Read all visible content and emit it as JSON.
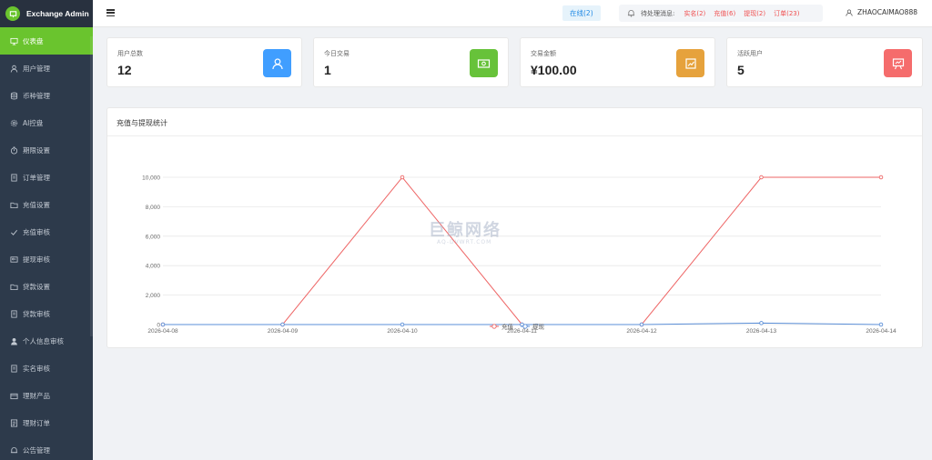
{
  "brand": {
    "title": "Exchange Admin"
  },
  "sidebar": {
    "items": [
      {
        "label": "仪表盘",
        "icon": "dashboard-icon",
        "active": true
      },
      {
        "label": "用户管理",
        "icon": "user-icon"
      },
      {
        "label": "币种管理",
        "icon": "database-icon"
      },
      {
        "label": "AI控盘",
        "icon": "gear-icon"
      },
      {
        "label": "期限设置",
        "icon": "timer-icon"
      },
      {
        "label": "订单管理",
        "icon": "document-icon"
      },
      {
        "label": "充值设置",
        "icon": "folder-icon"
      },
      {
        "label": "充值审核",
        "icon": "check-icon"
      },
      {
        "label": "提现审核",
        "icon": "card-icon"
      },
      {
        "label": "贷款设置",
        "icon": "folder-icon"
      },
      {
        "label": "贷款审核",
        "icon": "document-icon"
      },
      {
        "label": "个人信息审核",
        "icon": "person-filled-icon"
      },
      {
        "label": "实名审核",
        "icon": "document-icon"
      },
      {
        "label": "理财产品",
        "icon": "wallet-icon"
      },
      {
        "label": "理财订单",
        "icon": "list-icon"
      },
      {
        "label": "公告管理",
        "icon": "bell-icon"
      }
    ]
  },
  "header": {
    "online": "在线(2)",
    "pending_label": "待处理消息:",
    "pending": [
      "实名(2)",
      "充值(6)",
      "提现(2)",
      "订单(23)"
    ],
    "username": "ZHAOCAIMAO888"
  },
  "stats": [
    {
      "label": "用户总数",
      "value": "12",
      "color": "#409eff",
      "icon": "user-icon"
    },
    {
      "label": "今日交易",
      "value": "1",
      "color": "#67c23a",
      "icon": "money-icon"
    },
    {
      "label": "交易金额",
      "value": "¥100.00",
      "color": "#e6a23c",
      "icon": "trend-icon"
    },
    {
      "label": "活跃用户",
      "value": "5",
      "color": "#f56c6c",
      "icon": "presentation-icon"
    }
  ],
  "panel": {
    "title": "充值与提现统计"
  },
  "watermark": {
    "main": "巨鲸网络",
    "sub": "AQ-DVWRT.COM"
  },
  "chart_data": {
    "type": "line",
    "categories": [
      "2026-04-08",
      "2026-04-09",
      "2026-04-10",
      "2026-04-11",
      "2026-04-12",
      "2026-04-13",
      "2026-04-14"
    ],
    "series": [
      {
        "name": "充值",
        "values": [
          0,
          0,
          10000,
          0,
          0,
          10000,
          10000
        ],
        "color": "#ee6666"
      },
      {
        "name": "提现",
        "values": [
          0,
          0,
          0,
          0,
          0,
          100,
          0
        ],
        "color": "#5b8fd8"
      }
    ],
    "ylim": [
      0,
      10000
    ],
    "yticks": [
      "0",
      "2,000",
      "4,000",
      "6,000",
      "8,000",
      "10,000"
    ],
    "ytick_values": [
      0,
      2000,
      4000,
      6000,
      8000,
      10000
    ],
    "grid": true,
    "legend": "bottom-center"
  }
}
